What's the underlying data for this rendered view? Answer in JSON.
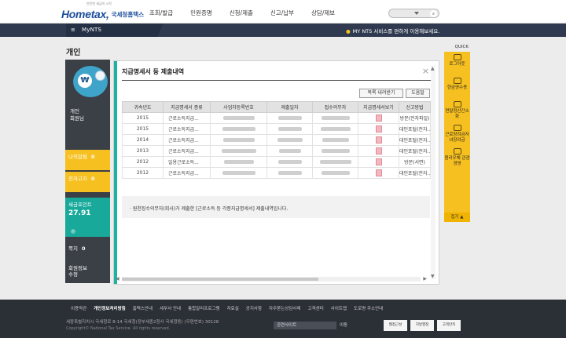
{
  "header": {
    "logo_text": "Hometax,",
    "logo_sub": "국세청홈택스",
    "logo_tag": "안전한 세금의 시작",
    "menu": [
      "조회/발급",
      "민원증명",
      "신청/제출",
      "신고/납부",
      "상담/제보"
    ]
  },
  "navbar": {
    "menu_label": "≡",
    "my_nts": "MyNTS",
    "notice": "MY NTS 서비스를 편하게 이용해보세요."
  },
  "left": {
    "page_title": "개인",
    "profile_label_1": "개인",
    "profile_label_2": "회원님",
    "boxes": [
      {
        "label": "나의알림",
        "count": "0"
      },
      {
        "label": "전자고지",
        "count": "0"
      },
      {
        "label": "세금포인트",
        "value": "27.91"
      },
      {
        "label": "쪽지",
        "count": "0"
      },
      {
        "label": "회원정보",
        "label2": "수정"
      }
    ]
  },
  "modal": {
    "title": "지급명세서 등 제출내역",
    "close": "×",
    "btn_print": "목록 내려받기",
    "btn_help": "도움말",
    "columns": [
      "귀속년도",
      "지급명세서 종류",
      "사업자등록번호",
      "제출일자",
      "접수의무자",
      "지급명세서보기",
      "신고방법"
    ],
    "rows": [
      {
        "year": "2015",
        "kind": "근로소득지급...",
        "method": "방문(전자파일)"
      },
      {
        "year": "2015",
        "kind": "근로소득지급...",
        "method": "대인포털(전자..."
      },
      {
        "year": "2014",
        "kind": "근로소득지급...",
        "method": "대인포털(전자..."
      },
      {
        "year": "2013",
        "kind": "근로소득지급...",
        "method": "대인포털(전자..."
      },
      {
        "year": "2012",
        "kind": "일용근로소득...",
        "method": "방문(서면)"
      },
      {
        "year": "2012",
        "kind": "근로소득지급...",
        "method": "대인포털(전자..."
      }
    ],
    "note": "· 원천징수의무자(회사)가 제출한 [근로소득 등 각종지급명세서] 제출내역입니다."
  },
  "quick": {
    "header": "QUICK",
    "items": [
      "로그아웃",
      "현금영수증",
      "연말정산간소화",
      "근로장려금자녀장려금",
      "원리우체 관광경영"
    ],
    "fold": "접기 ▲"
  },
  "footer": {
    "links": [
      "이용약관",
      "개인정보처리방침",
      "홈택스안내",
      "세무서 안내",
      "통합알리프로그램",
      "자료실",
      "공지사항",
      "자주묻는상담사례",
      "고객센터",
      "사이트맵",
      "도로명 주소안내"
    ],
    "address": "세종특별자치시 국세청로 8-14 국세청(정부세종2청사 국세청동) (우편번호) 30128",
    "copyright": "Copyright© National Tax Service. All rights reserved.",
    "related_select": "관련사이트",
    "go": "이동",
    "badges": [
      "웹접근성",
      "지방행정",
      "고객만족"
    ]
  },
  "colors": {
    "navy": "#2f3a50",
    "yellow": "#f7c021",
    "teal": "#18a99a",
    "dark_panel": "#3b3f46"
  }
}
